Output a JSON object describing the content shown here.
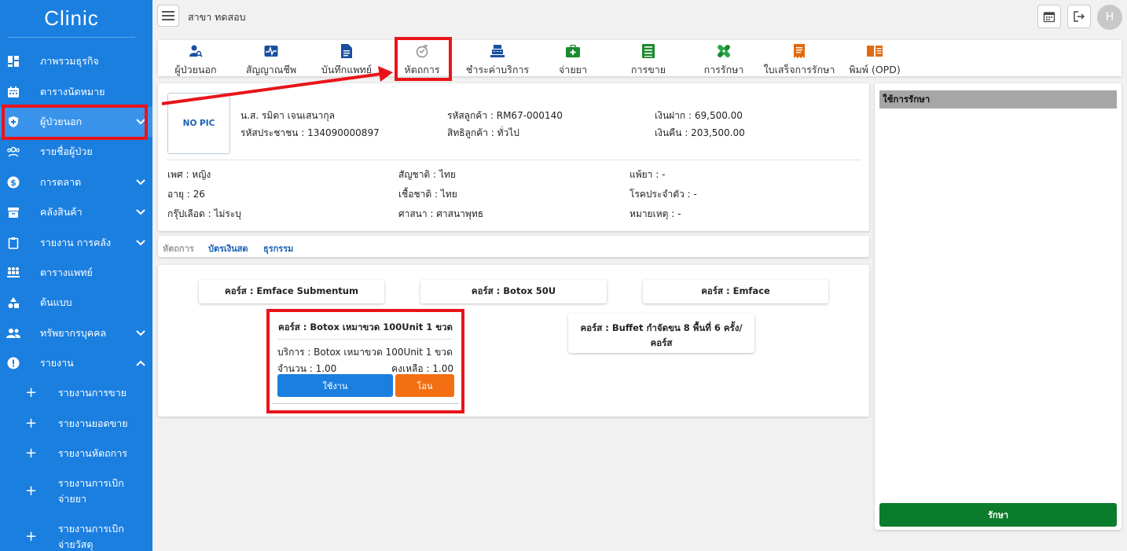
{
  "sidebar": {
    "brand": "Clinic",
    "items": [
      {
        "label": "ภาพรวมธุรกิจ",
        "icon": "dashboard-icon",
        "chevron": ""
      },
      {
        "label": "ตารางนัดหมาย",
        "icon": "calendar-icon",
        "chevron": ""
      },
      {
        "label": "ผู้ป่วยนอก",
        "icon": "shield-plus-icon",
        "chevron": "⌄"
      },
      {
        "label": "รายชื่อผู้ป่วย",
        "icon": "patients-icon",
        "chevron": ""
      },
      {
        "label": "การตลาด",
        "icon": "dollar-icon",
        "chevron": "⌄"
      },
      {
        "label": "คลังสินค้า",
        "icon": "archive-icon",
        "chevron": "⌄"
      },
      {
        "label": "รายงาน การคลัง",
        "icon": "clipboard-icon",
        "chevron": "⌄"
      },
      {
        "label": "ตารางแพทย์",
        "icon": "doctors-icon",
        "chevron": ""
      },
      {
        "label": "ต้นแบบ",
        "icon": "shapes-icon",
        "chevron": ""
      },
      {
        "label": "ทรัพยากรบุคคล",
        "icon": "people-icon",
        "chevron": "⌄"
      },
      {
        "label": "รายงาน",
        "icon": "alert-icon",
        "chevron": "⌃"
      }
    ],
    "subitems": [
      {
        "label": "รายงานการขาย"
      },
      {
        "label": "รายงานยอดขาย"
      },
      {
        "label": "รายงานหัตถการ"
      },
      {
        "label": "รายงานการเบิก จ่ายยา"
      },
      {
        "label": "รายงานการเบิก จ่ายวัสดุ"
      }
    ]
  },
  "topbar": {
    "branch": "สาขา ทดสอบ",
    "avatar_initial": "H"
  },
  "tabs": [
    {
      "label": "ผู้ป่วยนอก",
      "icon": "patient-search-icon",
      "color": "#1a4fa0"
    },
    {
      "label": "สัญญาณชีพ",
      "icon": "vital-signs-icon",
      "color": "#1a4fa0"
    },
    {
      "label": "บันทึกแพทย์",
      "icon": "document-icon",
      "color": "#1a4fa0"
    },
    {
      "label": "หัตถการ",
      "icon": "procedure-icon",
      "color": "#888888"
    },
    {
      "label": "ชำระค่าบริการ",
      "icon": "cash-register-icon",
      "color": "#1a4fa0"
    },
    {
      "label": "จ่ายยา",
      "icon": "medkit-icon",
      "color": "#1c8a2e"
    },
    {
      "label": "การขาย",
      "icon": "sales-list-icon",
      "color": "#1c8a2e"
    },
    {
      "label": "การรักษา",
      "icon": "bandage-icon",
      "color": "#1c8a2e"
    },
    {
      "label": "ใบเสร็จการรักษา",
      "icon": "receipt-icon",
      "color": "#e06a10"
    },
    {
      "label": "พิมพ์ (OPD)",
      "icon": "print-book-icon",
      "color": "#e06a10"
    }
  ],
  "patient": {
    "photo": "NO PIC",
    "name": "น.ส. รมิดา เจนเสนากุล",
    "national_id": "รหัสประชาชน : 134090000897",
    "customer_code": "รหัสลูกค้า : RM67-000140",
    "customer_right": "สิทธิลูกค้า : ทั่วไป",
    "deposit": "เงินฝาก : 69,500.00",
    "refund": "เงินคืน : 203,500.00",
    "gender": "เพศ : หญิง",
    "age": "อายุ : 26",
    "blood": "กรุ๊ปเลือด : ไม่ระบุ",
    "nationality": "สัญชาติ : ไทย",
    "race": "เชื้อชาติ : ไทย",
    "religion": "ศาสนา : ศาสนาพุทธ",
    "allergy": "แพ้ยา : -",
    "disease": "โรคประจำตัว : -",
    "note": "หมายเหตุ : -"
  },
  "subtabs": [
    {
      "label": "หัตถการ",
      "color": "#9a9a9a"
    },
    {
      "label": "บัตรเงินสด",
      "color": "#1a5fb4"
    },
    {
      "label": "ธุรกรรม",
      "color": "#1a5fb4"
    }
  ],
  "courses": {
    "c1": "คอร์ส : Emface Submentum",
    "c2": "คอร์ส : Botox 50U",
    "c3": "คอร์ส : Emface",
    "buffet_line1": "คอร์ส : Buffet กำจัดขน 8 พื้นที่ 6 ครั้ง/",
    "buffet_line2": "คอร์ส",
    "detail": {
      "title": "คอร์ส : Botox เหมาขวด 100Unit 1 ขวด",
      "service": "บริการ : Botox เหมาขวด 100Unit 1 ขวด",
      "quantity": "จำนวน : 1.00",
      "remaining": "คงเหลือ : 1.00",
      "use_label": "ใช้งาน",
      "transfer_label": "โอน"
    }
  },
  "right_panel": {
    "title": "ใช้การรักษา",
    "treat_label": "รักษา"
  },
  "colors": {
    "sidebar": "#1b7fe0",
    "highlight": "#e8141a",
    "primary": "#1b7fe0",
    "orange": "#f36f12",
    "green": "#0b7c2b"
  }
}
